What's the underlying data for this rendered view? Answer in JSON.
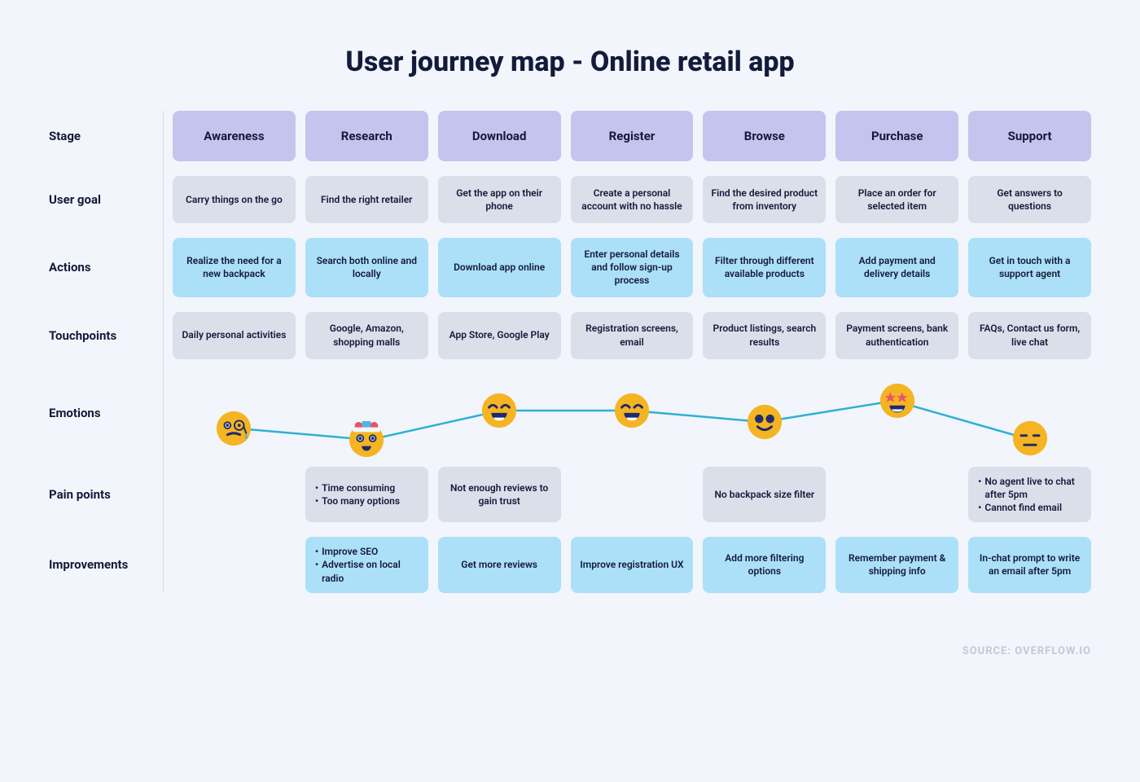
{
  "title": "User journey map - Online retail app",
  "row_labels": {
    "stage": "Stage",
    "user_goal": "User goal",
    "actions": "Actions",
    "touchpoints": "Touchpoints",
    "emotions": "Emotions",
    "pain_points": "Pain points",
    "improvements": "Improvements"
  },
  "stages": [
    "Awareness",
    "Research",
    "Download",
    "Register",
    "Browse",
    "Purchase",
    "Support"
  ],
  "user_goals": [
    "Carry things on the go",
    "Find the right retailer",
    "Get the app on their phone",
    "Create a personal account with no hassle",
    "Find the desired product from inventory",
    "Place an order for selected item",
    "Get answers to questions"
  ],
  "actions": [
    "Realize the need for a new backpack",
    "Search both online and locally",
    "Download app online",
    "Enter personal details and follow sign-up process",
    "Filter through different available products",
    "Add payment and delivery details",
    "Get in touch with a support agent"
  ],
  "touchpoints": [
    "Daily personal activities",
    "Google, Amazon, shopping malls",
    "App Store, Google Play",
    "Registration screens, email",
    "Product listings, search results",
    "Payment screens, bank authentication",
    "FAQs, Contact us form, live chat"
  ],
  "emotions": [
    {
      "name": "worried-sweat",
      "y": 44
    },
    {
      "name": "exploding-head",
      "y": 58
    },
    {
      "name": "grin-closed-eyes",
      "y": 22
    },
    {
      "name": "grin-closed-eyes",
      "y": 22
    },
    {
      "name": "smile",
      "y": 36
    },
    {
      "name": "star-eyes",
      "y": 10
    },
    {
      "name": "expressionless",
      "y": 56
    }
  ],
  "pain_points": [
    null,
    {
      "bullets": [
        "Time consuming",
        "Too many options"
      ]
    },
    {
      "text": "Not enough reviews to gain trust"
    },
    null,
    {
      "text": "No backpack size filter"
    },
    null,
    {
      "bullets": [
        "No agent live to chat after 5pm",
        "Cannot find email"
      ]
    }
  ],
  "improvements": [
    null,
    {
      "bullets": [
        "Improve SEO",
        "Advertise on local radio"
      ]
    },
    {
      "text": "Get more reviews"
    },
    {
      "text": "Improve registration UX"
    },
    {
      "text": "Add more filtering options"
    },
    {
      "text": "Remember payment & shipping info"
    },
    {
      "text": "In-chat prompt to write an email after 5pm"
    }
  ],
  "source": "SOURCE: OVERFLOW.IO",
  "colors": {
    "line": "#2db1d4"
  }
}
